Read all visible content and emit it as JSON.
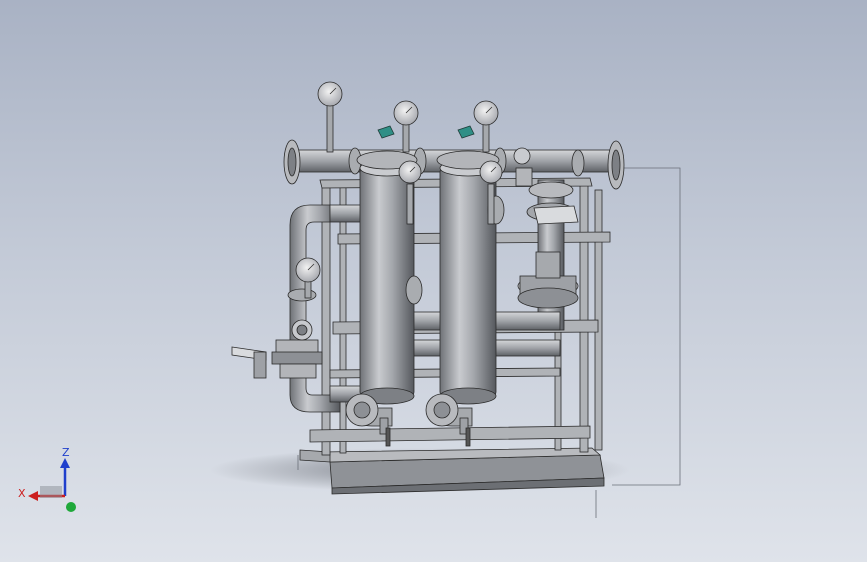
{
  "triad": {
    "x_label": "X",
    "z_label": "Z",
    "x_color": "#cc1f1f",
    "z_color": "#1f3fcc",
    "y_color": "#1fa83a"
  },
  "model": {
    "description_icons": [
      "pressure-gauge-icon",
      "valve-handle-icon",
      "flange-icon"
    ],
    "colors": {
      "steel": "#9ea1a6",
      "steel_dark": "#6c6f74",
      "steel_light": "#d7d9dc",
      "handle": "#2f8f86",
      "edge": "#2b2b2b"
    }
  }
}
